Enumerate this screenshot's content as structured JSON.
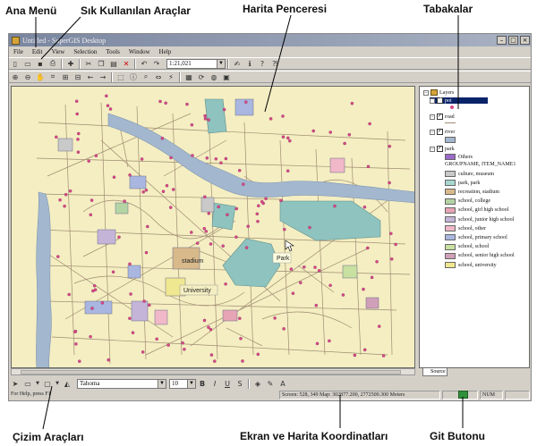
{
  "callouts": {
    "main_menu": "Ana Menü",
    "common_tools": "Sık Kullanılan Araçlar",
    "map_window": "Harita Penceresi",
    "layers": "Tabakalar",
    "drawing_tools": "Çizim Araçları",
    "coordinates": "Ekran ve Harita Koordinatları",
    "go_button": "Git Butonu"
  },
  "window": {
    "title": "Untitled - SuperGIS Desktop",
    "menus": [
      "File",
      "Edit",
      "View",
      "Selection",
      "Tools",
      "Window",
      "Help"
    ],
    "scale": "1:21,021"
  },
  "map": {
    "labels": {
      "stadium": "stadium",
      "university": "University",
      "park": "Park"
    }
  },
  "toc": {
    "root": "Layers",
    "layers": [
      {
        "name": "poi",
        "selected": true
      },
      {
        "name": "road",
        "selected": false
      },
      {
        "name": "river",
        "selected": false
      },
      {
        "name": "park",
        "selected": false
      }
    ],
    "others": "Others",
    "field": "GROUPNAME, ITEM_NAME1",
    "legend": [
      {
        "label": "culture, museum",
        "color": "#c9c9c9"
      },
      {
        "label": "park, park",
        "color": "#a8d9d0"
      },
      {
        "label": "recreation, stadium",
        "color": "#d8b98a"
      },
      {
        "label": "school, college",
        "color": "#b4d4a4"
      },
      {
        "label": "school, girl high school",
        "color": "#e6a4b4"
      },
      {
        "label": "school, junior high school",
        "color": "#c4b4d8"
      },
      {
        "label": "school, other",
        "color": "#f0b8c8"
      },
      {
        "label": "school, primary school",
        "color": "#a9b7e0"
      },
      {
        "label": "school, school",
        "color": "#c8e0a0"
      },
      {
        "label": "school, senior high school",
        "color": "#d0a0b8"
      },
      {
        "label": "school, university",
        "color": "#f0e890"
      }
    ],
    "source_tab": "Source"
  },
  "drawbar": {
    "font": "Tahoma",
    "size": "10"
  },
  "status": {
    "help": "For Help, press F1",
    "coords": "Screen: 528, 349  Map: 302877.200, 2772500.300 Meters",
    "num": "NUM"
  },
  "colors": {
    "river": "#a3b7cf",
    "park": "#8fc3bf",
    "land": "#f4eec2",
    "poi": "#d94a8a",
    "road": "#a08c72"
  }
}
